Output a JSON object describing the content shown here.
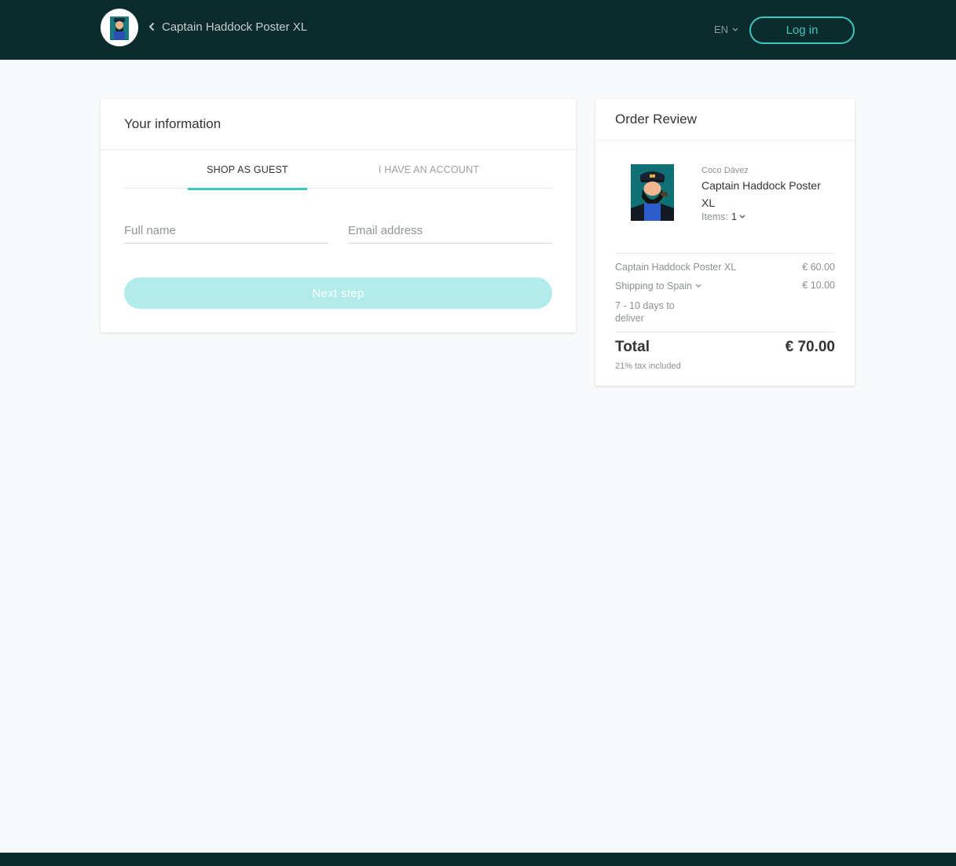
{
  "header": {
    "back_title": "Captain Haddock Poster XL",
    "language": "EN",
    "login_label": "Log in"
  },
  "info": {
    "title": "Your information",
    "tabs": [
      {
        "label": "SHOP AS GUEST",
        "active": true
      },
      {
        "label": "I HAVE AN ACCOUNT",
        "active": false
      }
    ],
    "full_name": {
      "value": "",
      "placeholder": "Full name"
    },
    "email": {
      "value": "",
      "placeholder": "Email address"
    },
    "next_label": "Next step"
  },
  "order": {
    "title": "Order Review",
    "seller": "Coco Dávez",
    "product_name": "Captain Haddock Poster XL",
    "items_label": "Items:",
    "items_qty": "1",
    "lines": [
      {
        "label": "Captain Haddock Poster XL",
        "value": "€ 60.00"
      },
      {
        "label": "Shipping to Spain",
        "value": "€ 10.00"
      }
    ],
    "delivery": "7 - 10 days to deliver",
    "total_label": "Total",
    "total_value": "€ 70.00",
    "tax_note": "21% tax included"
  },
  "colors": {
    "header_bg": "#0c2b2c",
    "accent": "#3cc7c3",
    "button_disabled": "#b1eceb"
  },
  "icons": [
    "avatar-image",
    "chevron-left-icon",
    "chevron-down-icon",
    "poster-thumbnail"
  ]
}
